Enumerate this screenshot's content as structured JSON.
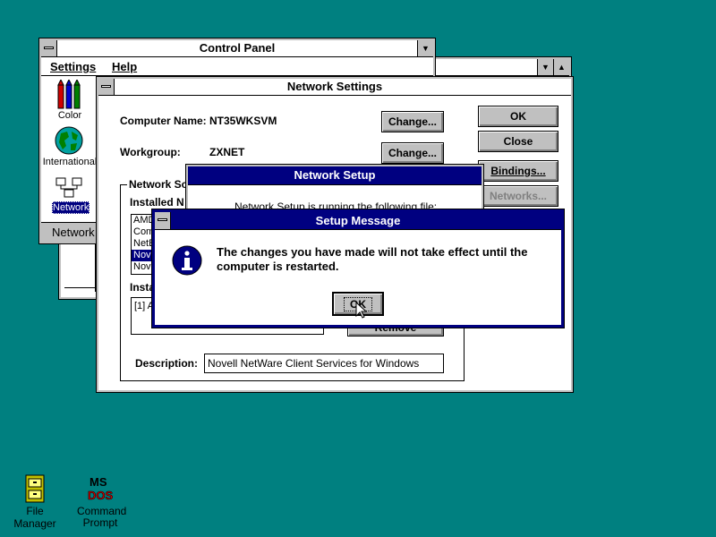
{
  "control_panel": {
    "title": "Control Panel",
    "menu": {
      "settings": "Settings",
      "help": "Help"
    },
    "icons": [
      {
        "label": "Color"
      },
      {
        "label": "International"
      },
      {
        "label": "Network"
      }
    ],
    "status": "Network"
  },
  "network_settings": {
    "title": "Network Settings",
    "computer_name_label": "Computer Name:",
    "computer_name": "NT35WKSVM",
    "workgroup_label": "Workgroup:",
    "workgroup": "ZXNET",
    "change_label": "Change...",
    "ok_label": "OK",
    "close_label": "Close",
    "bindings_label": "Bindings...",
    "networks_label": "Networks...",
    "group_label": "Network So",
    "installed_label": "Installed N",
    "installed_items": [
      "AMD",
      "Com",
      "NetB",
      "Nov",
      "Nov"
    ],
    "insta_label": "Insta",
    "insta_item": "[1] A",
    "remove_label": "Remove",
    "description_label": "Description:",
    "description": "Novell NetWare Client Services for Windows"
  },
  "network_setup": {
    "title": "Network Setup",
    "body": "Network Setup is running the following file:"
  },
  "setup_message": {
    "title": "Setup Message",
    "message_line1": "The changes you have made will not take effect until the",
    "message_line2": "computer is restarted.",
    "ok_label": "OK"
  },
  "desktop": {
    "file_manager": "File Manager",
    "command_prompt_line1": "Command",
    "command_prompt_line2": "Prompt",
    "ms_text_1": "MS",
    "ms_text_2": "DOS"
  }
}
